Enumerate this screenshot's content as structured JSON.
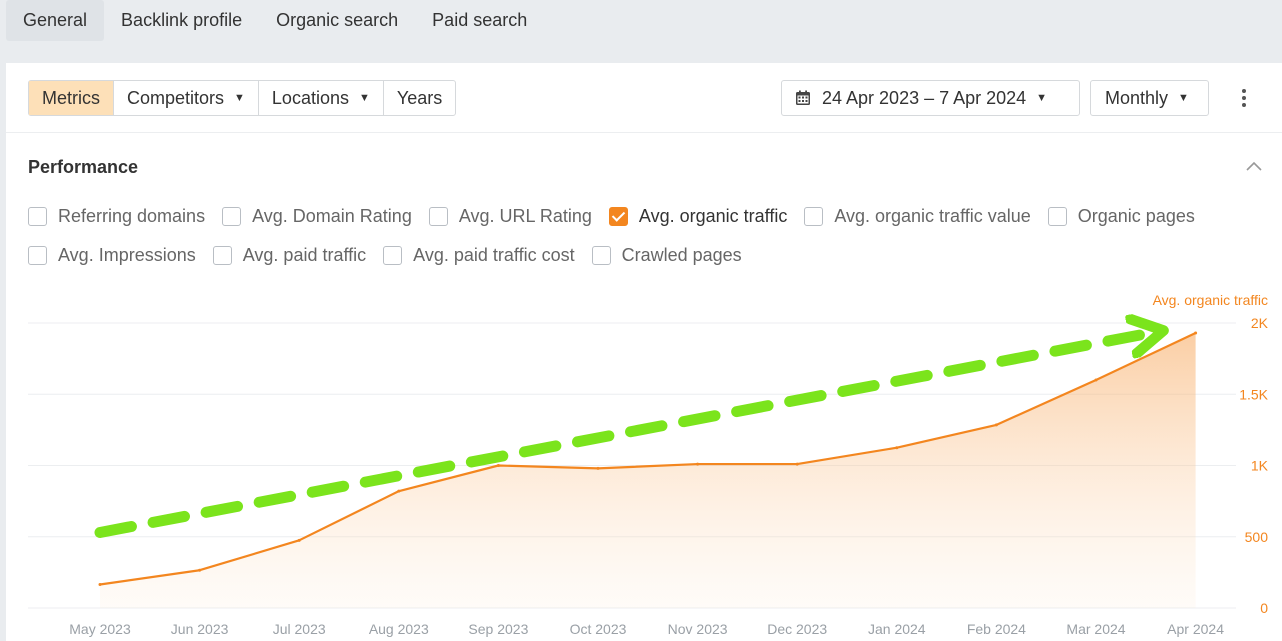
{
  "tabs": [
    {
      "label": "General",
      "active": true
    },
    {
      "label": "Backlink profile",
      "active": false
    },
    {
      "label": "Organic search",
      "active": false
    },
    {
      "label": "Paid search",
      "active": false
    }
  ],
  "toolbar": {
    "segments": [
      {
        "label": "Metrics",
        "active": true,
        "dropdown": false
      },
      {
        "label": "Competitors",
        "active": false,
        "dropdown": true
      },
      {
        "label": "Locations",
        "active": false,
        "dropdown": true
      },
      {
        "label": "Years",
        "active": false,
        "dropdown": false
      }
    ],
    "date_range": "24 Apr 2023 – 7 Apr 2024",
    "interval": "Monthly",
    "icons": {
      "calendar": "calendar-icon",
      "more": "more-vertical-icon",
      "caret": "caret-down-icon"
    }
  },
  "performance": {
    "title": "Performance",
    "collapse_icon": "chevron-up-icon",
    "metrics_row1": [
      {
        "label": "Referring domains",
        "checked": false
      },
      {
        "label": "Avg. Domain Rating",
        "checked": false
      },
      {
        "label": "Avg. URL Rating",
        "checked": false
      },
      {
        "label": "Avg. organic traffic",
        "checked": true
      },
      {
        "label": "Avg. organic traffic value",
        "checked": false
      },
      {
        "label": "Organic pages",
        "checked": false
      }
    ],
    "metrics_row2": [
      {
        "label": "Avg. Impressions",
        "checked": false
      },
      {
        "label": "Avg. paid traffic",
        "checked": false
      },
      {
        "label": "Avg. paid traffic cost",
        "checked": false
      },
      {
        "label": "Crawled pages",
        "checked": false
      }
    ]
  },
  "colors": {
    "accent": "#f3861f",
    "active_segment": "#fde0b8",
    "annotation_arrow": "#7be41c"
  },
  "chart_data": {
    "type": "area",
    "series_label": "Avg. organic traffic",
    "categories": [
      "May 2023",
      "Jun 2023",
      "Jul 2023",
      "Aug 2023",
      "Sep 2023",
      "Oct 2023",
      "Nov 2023",
      "Dec 2023",
      "Jan 2024",
      "Feb 2024",
      "Mar 2024",
      "Apr 2024"
    ],
    "series": [
      {
        "name": "Avg. organic traffic",
        "values": [
          165,
          265,
          475,
          820,
          1000,
          980,
          1010,
          1010,
          1125,
          1285,
          1600,
          1930
        ]
      }
    ],
    "y_ticks": [
      "0",
      "500",
      "1K",
      "1.5K",
      "2K"
    ],
    "ylim": [
      0,
      2000
    ],
    "y_axis_side": "right",
    "grid": true,
    "annotation": {
      "type": "dashed-arrow",
      "description": "upward trend",
      "from": {
        "x": "May 2023",
        "y": 530
      },
      "to": {
        "x": "Apr 2024",
        "y": 2000
      }
    }
  }
}
